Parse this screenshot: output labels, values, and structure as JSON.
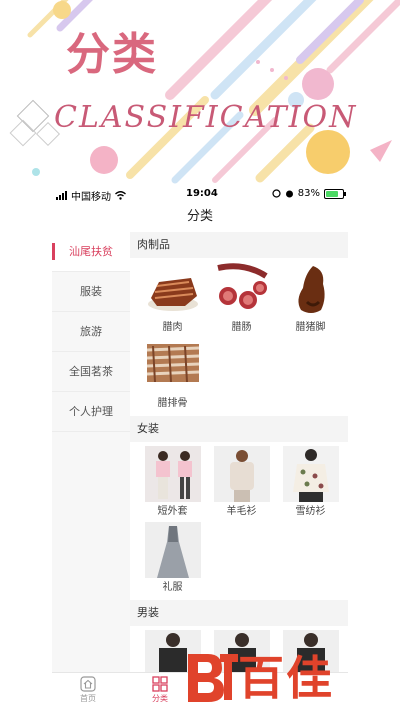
{
  "banner": {
    "title": "分类",
    "subtitle": "CLASSIFICATION"
  },
  "status_bar": {
    "carrier": "中国移动",
    "time": "19:04",
    "battery": "83%",
    "battery_level": 0.83
  },
  "nav": {
    "title": "分类"
  },
  "sidebar": {
    "items": [
      {
        "label": "汕尾扶贫",
        "active": true
      },
      {
        "label": "服装",
        "active": false
      },
      {
        "label": "旅游",
        "active": false
      },
      {
        "label": "全国茗茶",
        "active": false
      },
      {
        "label": "个人护理",
        "active": false
      }
    ]
  },
  "content": {
    "sections": [
      {
        "title": "肉制品",
        "items": [
          {
            "label": "腊肉",
            "icon": "cured-pork-photo"
          },
          {
            "label": "腊肠",
            "icon": "sausage-photo"
          },
          {
            "label": "腊猪脚",
            "icon": "pig-trotter-photo"
          },
          {
            "label": "腊排骨",
            "icon": "cured-ribs-photo"
          }
        ]
      },
      {
        "title": "女装",
        "items": [
          {
            "label": "短外套",
            "icon": "short-jacket-photo"
          },
          {
            "label": "羊毛衫",
            "icon": "sweater-photo"
          },
          {
            "label": "雪纺衫",
            "icon": "chiffon-blouse-photo"
          },
          {
            "label": "礼服",
            "icon": "evening-gown-photo"
          }
        ]
      },
      {
        "title": "男装",
        "items": [
          {
            "label": "",
            "icon": "menswear-photo"
          },
          {
            "label": "",
            "icon": "menswear-photo"
          },
          {
            "label": "",
            "icon": "menswear-photo"
          }
        ]
      }
    ]
  },
  "tabbar": {
    "items": [
      {
        "label": "首页",
        "icon": "home-icon"
      },
      {
        "label": "分类",
        "icon": "category-grid-icon"
      }
    ]
  },
  "watermark": {
    "text": "百佳"
  },
  "colors": {
    "accent": "#d9405e",
    "banner_pink": "#d9687e",
    "watermark_red": "#e0432b"
  }
}
